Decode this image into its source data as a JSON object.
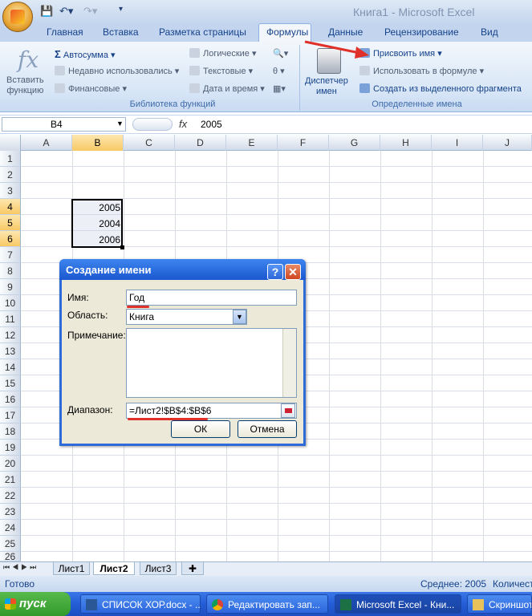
{
  "title": "Книга1 - Microsoft Excel",
  "tabs": [
    "Главная",
    "Вставка",
    "Разметка страницы",
    "Формулы",
    "Данные",
    "Рецензирование",
    "Вид"
  ],
  "ribbon": {
    "insert_function": [
      "Вставить",
      "функцию"
    ],
    "autosum": "Автосумма",
    "recent": "Недавно использовались",
    "financial": "Финансовые",
    "logical": "Логические",
    "text": "Текстовые",
    "datetime": "Дата и время",
    "library_label": "Библиотека функций",
    "name_manager": [
      "Диспетчер",
      "имен"
    ],
    "define_name": "Присвоить имя",
    "use_in_formula": "Использовать в формуле",
    "create_from_selection": "Создать из выделенного фрагмента",
    "defined_names_label": "Определенные имена"
  },
  "formula_bar": {
    "name_box": "B4",
    "fx": "fx",
    "value": "2005"
  },
  "columns": [
    "A",
    "B",
    "C",
    "D",
    "E",
    "F",
    "G",
    "H",
    "I",
    "J"
  ],
  "rows": [
    "1",
    "2",
    "3",
    "4",
    "5",
    "6",
    "7",
    "8",
    "9",
    "10",
    "11",
    "12",
    "13",
    "14",
    "15",
    "16",
    "17",
    "18",
    "19",
    "20",
    "21",
    "22",
    "23",
    "24",
    "25",
    "26"
  ],
  "cells": {
    "b4": "2005",
    "b5": "2004",
    "b6": "2006"
  },
  "dialog": {
    "title": "Создание имени",
    "name_label": "Имя:",
    "name_value": "Год",
    "scope_label": "Область:",
    "scope_value": "Книга",
    "comment_label": "Примечание:",
    "range_label": "Диапазон:",
    "range_value": "=Лист2!$B$4:$B$6",
    "ok": "ОК",
    "cancel": "Отмена",
    "help": "?",
    "close": "✕"
  },
  "sheets": [
    "Лист1",
    "Лист2",
    "Лист3"
  ],
  "status": {
    "ready": "Готово",
    "average": "Среднее: 2005",
    "count": "Количест"
  },
  "taskbar": {
    "start": "пуск",
    "items": [
      "СПИСОК ХОР.docx - ...",
      "Редактировать зап...",
      "Microsoft Excel - Кни...",
      "Скриншоты"
    ]
  },
  "colors": {
    "accent": "#15428b",
    "annotation": "#e0302a",
    "selection": "#f8c965"
  }
}
